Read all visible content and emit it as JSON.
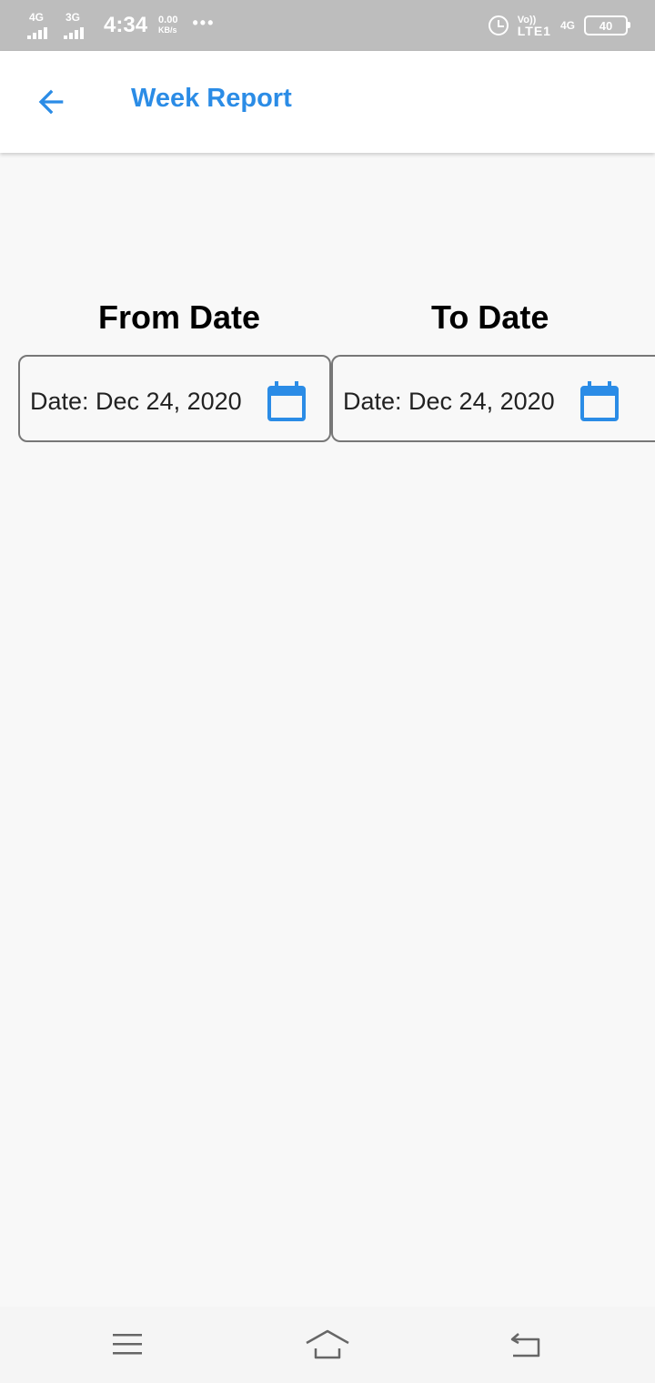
{
  "status_bar": {
    "sim1_network": "4G",
    "sim2_network": "3G",
    "time": "4:34",
    "speed_value": "0.00",
    "speed_unit": "KB/s",
    "overflow": "•••",
    "volte_top": "Vo))",
    "volte_bottom": "LTE1",
    "data_network": "4G",
    "battery_level": "40"
  },
  "app_bar": {
    "title": "Week Report",
    "back_icon": "arrow-back-icon"
  },
  "report": {
    "from": {
      "label": "From Date",
      "value": "Date: Dec 24, 2020",
      "icon": "calendar-icon"
    },
    "to": {
      "label": "To Date",
      "value": "Date: Dec 24, 2020",
      "icon": "calendar-icon"
    }
  },
  "nav_bar": {
    "menu_icon": "menu-icon",
    "home_icon": "home-icon",
    "back_icon": "back-icon"
  },
  "colors": {
    "accent": "#2b8ce6",
    "calendar": "#2b8ce6",
    "status_bar": "#bdbdbd",
    "background": "#f8f8f8"
  }
}
